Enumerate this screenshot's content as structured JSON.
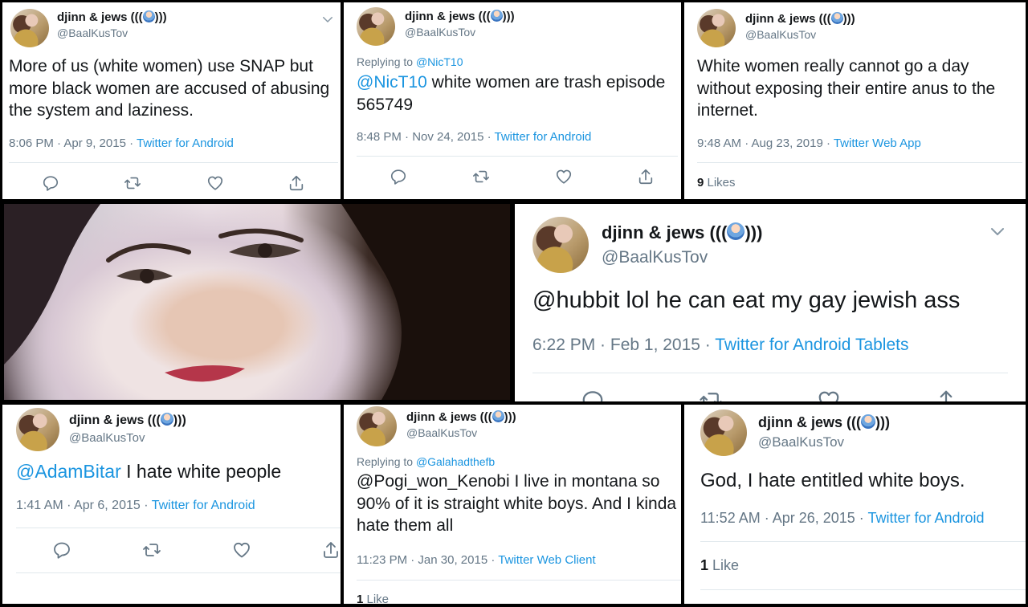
{
  "display_name": "djinn & jews (((🧞‍♂️)))",
  "name_text": "djinn & jews (((",
  "name_close": ")))",
  "handle": "@BaalKusTov",
  "tweets": [
    {
      "text": "More of us (white women) use SNAP but more black women are accused of abusing the system and laziness.",
      "time": "8:06 PM · Apr 9, 2015 · ",
      "source": "Twitter for Android"
    },
    {
      "reply_prefix": "Replying to ",
      "reply_to": "@NicT10",
      "mention": "@NicT10",
      "text": " white women are trash episode 565749",
      "time": "8:48 PM · Nov 24, 2015 · ",
      "source": "Twitter for Android"
    },
    {
      "text": "White women really cannot go a day without exposing their entire anus to the internet.",
      "time": "9:48 AM · Aug 23, 2019 · ",
      "source": "Twitter Web App",
      "likes_count": "9",
      "likes_label": " Likes"
    },
    {
      "text": "@hubbit lol he can eat my gay jewish ass",
      "time": "6:22 PM · Feb 1, 2015 · ",
      "source": "Twitter for Android Tablets"
    },
    {
      "mention": "@AdamBitar",
      "text": " I hate white people",
      "time": "1:41 AM · Apr 6, 2015 · ",
      "source": "Twitter for Android"
    },
    {
      "reply_prefix": "Replying to ",
      "reply_to": "@Galahadthefb",
      "text": "@Pogi_won_Kenobi I live in montana so 90% of it is straight white boys. And I kinda hate them all",
      "time": "11:23 PM · Jan 30, 2015 · ",
      "source": "Twitter Web Client",
      "likes_count": "1",
      "likes_label": " Like"
    },
    {
      "text": "God, I hate entitled white boys.",
      "time": "11:52 AM · Apr 26, 2015 · ",
      "source": "Twitter for Android",
      "likes_count": "1",
      "likes_label": " Like"
    }
  ],
  "icons": {
    "reply": "reply-icon",
    "retweet": "retweet-icon",
    "like": "heart-icon",
    "share": "share-icon",
    "menu": "chevron-down-icon"
  },
  "colors": {
    "link": "#1b95e0",
    "muted": "#657786",
    "text": "#14171a"
  }
}
